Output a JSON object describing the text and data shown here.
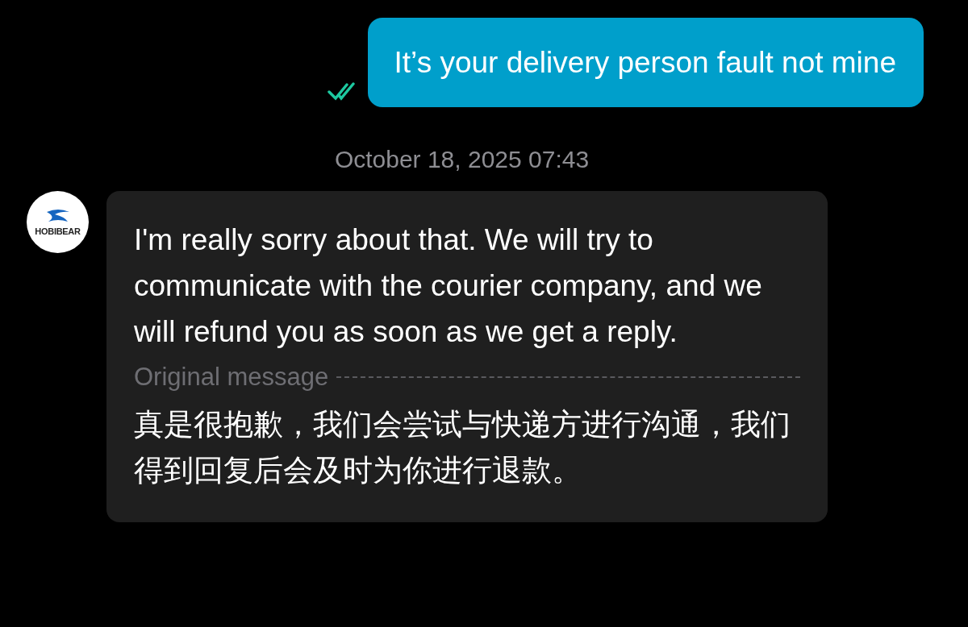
{
  "messages": [
    {
      "kind": "outgoing",
      "text": "It’s your delivery person fault not mine",
      "read": true
    },
    {
      "kind": "timestamp",
      "text": "October 18, 2025 07:43"
    },
    {
      "kind": "incoming",
      "avatar_text": "HOBIBEAR",
      "text": "I'm really sorry about that. We will try to communicate with the courier company, and we will refund you as soon as we get a reply.",
      "original_label": "Original message",
      "original_text": "真是很抱歉，我们会尝试与快递方进行沟通，我们得到回复后会及时为你进行退款。"
    }
  ]
}
